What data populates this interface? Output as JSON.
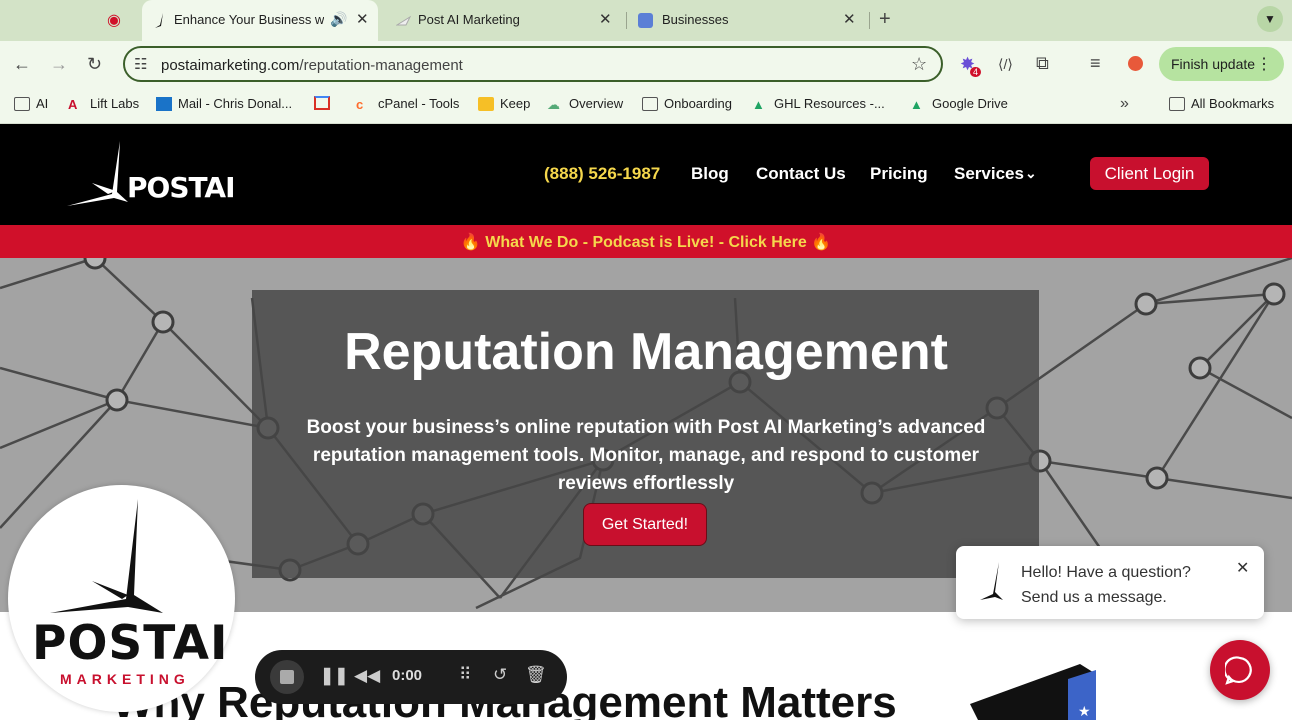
{
  "browser": {
    "tabs": [
      {
        "title": "Enhance Your Business w",
        "active": true
      },
      {
        "title": "Post AI Marketing",
        "active": false
      },
      {
        "title": "Businesses",
        "active": false
      }
    ],
    "new_tab_glyph": "+",
    "url_domain": "postaimarketing.com",
    "url_path": "/reputation-management",
    "extension_badge": "4",
    "finish_update_label": "Finish update"
  },
  "bookmarks": [
    {
      "label": "AI",
      "icon": "folder-icon"
    },
    {
      "label": "Lift Labs",
      "icon": "lift-labs-icon"
    },
    {
      "label": "Mail - Chris Donal...",
      "icon": "outlook-icon"
    },
    {
      "label": "",
      "icon": "gmail-icon"
    },
    {
      "label": "cPanel - Tools",
      "icon": "cpanel-icon"
    },
    {
      "label": "Keep",
      "icon": "keep-icon"
    },
    {
      "label": "Overview",
      "icon": "overview-icon"
    },
    {
      "label": "Onboarding",
      "icon": "folder-icon"
    },
    {
      "label": "GHL Resources -...",
      "icon": "drive-icon"
    },
    {
      "label": "Google Drive",
      "icon": "drive-icon"
    },
    {
      "label": "All Bookmarks",
      "icon": "folder-icon"
    }
  ],
  "site": {
    "logo_text": "POSTAI",
    "nav": {
      "phone": "(888) 526-1987",
      "blog": "Blog",
      "contact": "Contact Us",
      "pricing": "Pricing",
      "services": "Services",
      "login": "Client Login"
    },
    "promo": "🔥 What We Do -  Podcast is Live! - Click Here 🔥",
    "hero": {
      "title": "Reputation Management",
      "subtitle": "Boost your business’s online reputation with Post AI Marketing’s advanced reputation management tools. Monitor, manage, and respond to customer reviews effortlessly",
      "cta": "Get Started!"
    },
    "section_title": "Why Reputation Management Matters"
  },
  "overlay": {
    "logo_word": "POSTAI",
    "logo_sub": "MARKETING",
    "recorder_time": "0:00",
    "chat_line1": "Hello! Have a question?",
    "chat_line2": "Send us a message."
  },
  "colors": {
    "brand_red": "#c8102e",
    "promo_text": "#f5d74c",
    "chrome_green": "#d3e3c7"
  }
}
